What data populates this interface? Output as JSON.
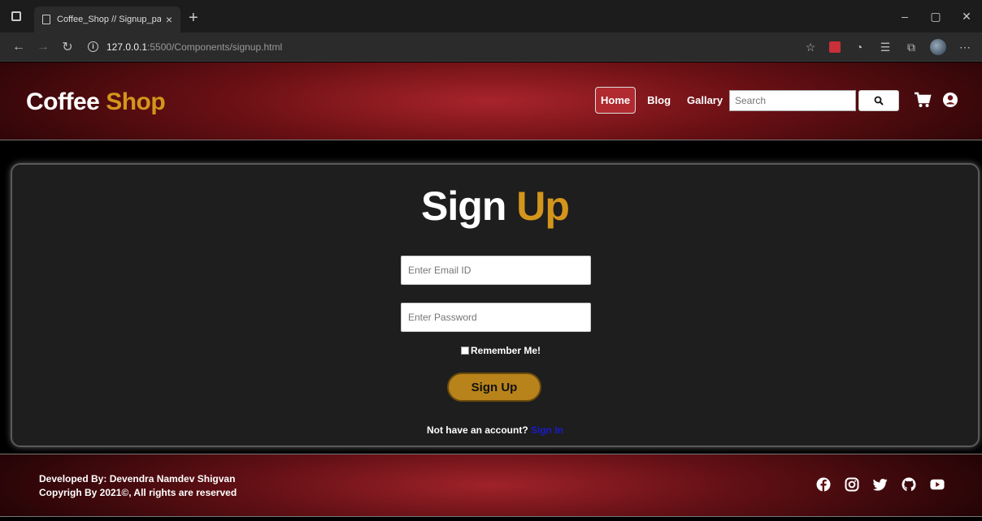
{
  "browser": {
    "tab_title": "Coffee_Shop // Signup_page",
    "tab_close": "×",
    "new_tab": "+",
    "url_host": "127.0.0.1",
    "url_path": ":5500/Components/signup.html",
    "window_controls": [
      "–",
      "▢",
      "✕"
    ]
  },
  "header": {
    "logo_main": "Coffee",
    "logo_accent": "Shop",
    "nav": [
      "Home",
      "Blog",
      "Gallary"
    ],
    "search_placeholder": "Search"
  },
  "form": {
    "title_main": "Sign",
    "title_accent": "Up",
    "email_placeholder": "Enter Email ID",
    "password_placeholder": "Enter Password",
    "remember_label": "Remember Me!",
    "submit_label": "Sign Up",
    "account_prompt": "Not have an account?",
    "account_link": "Sign In"
  },
  "footer": {
    "developer": "Developed By: Devendra Namdev Shigvan",
    "copyright": "Copyrigh By 2021©, All rights are reserved",
    "social_icons": [
      "facebook-icon",
      "instagram-icon",
      "twitter-icon",
      "github-icon",
      "youtube-icon"
    ]
  },
  "colors": {
    "accent": "#d4951c",
    "header_red": "#a8242b",
    "link_blue": "#1a1acc",
    "button_gold": "#b8831a"
  }
}
